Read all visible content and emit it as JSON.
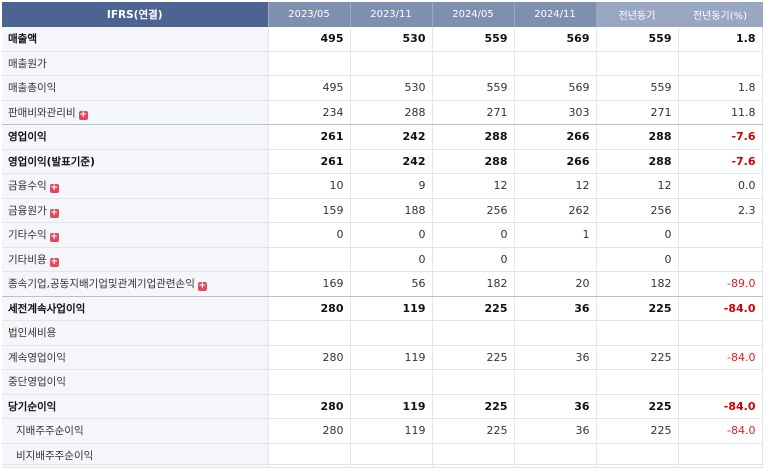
{
  "header": {
    "title": "IFRS(연결)",
    "columns": [
      "2023/05",
      "2023/11",
      "2024/05",
      "2024/11",
      "전년동기",
      "전년동기(%)"
    ]
  },
  "rows": [
    {
      "label": "매출액",
      "bold": true,
      "values": [
        "495",
        "530",
        "559",
        "569",
        "559",
        "1.8"
      ],
      "neg": false
    },
    {
      "label": "매출원가",
      "values": [
        "",
        "",
        "",
        "",
        "",
        ""
      ],
      "neg": false
    },
    {
      "label": "매출총이익",
      "values": [
        "495",
        "530",
        "559",
        "569",
        "559",
        "1.8"
      ],
      "neg": false
    },
    {
      "label": "판매비와관리비",
      "plus": true,
      "values": [
        "234",
        "288",
        "271",
        "303",
        "271",
        "11.8"
      ],
      "neg": false
    },
    {
      "label": "영업이익",
      "bold": true,
      "values": [
        "261",
        "242",
        "288",
        "266",
        "288",
        "-7.6"
      ],
      "neg": true
    },
    {
      "label": "영업이익(발표기준)",
      "bold": true,
      "values": [
        "261",
        "242",
        "288",
        "266",
        "288",
        "-7.6"
      ],
      "neg": true
    },
    {
      "label": "금융수익",
      "plus": true,
      "values": [
        "10",
        "9",
        "12",
        "12",
        "12",
        "0.0"
      ],
      "neg": false
    },
    {
      "label": "금융원가",
      "plus": true,
      "values": [
        "159",
        "188",
        "256",
        "262",
        "256",
        "2.3"
      ],
      "neg": false
    },
    {
      "label": "기타수익",
      "plus": true,
      "values": [
        "0",
        "0",
        "0",
        "1",
        "0",
        ""
      ],
      "neg": false
    },
    {
      "label": "기타비용",
      "plus": true,
      "values": [
        "",
        "0",
        "0",
        "",
        "0",
        ""
      ],
      "neg": false
    },
    {
      "label": "종속기업,공동지배기업및관계기업관련손익",
      "plus": true,
      "values": [
        "169",
        "56",
        "182",
        "20",
        "182",
        "-89.0"
      ],
      "neg": true
    },
    {
      "label": "세전계속사업이익",
      "bold": true,
      "values": [
        "280",
        "119",
        "225",
        "36",
        "225",
        "-84.0"
      ],
      "neg": true
    },
    {
      "label": "법인세비용",
      "values": [
        "",
        "",
        "",
        "",
        "",
        ""
      ],
      "neg": false
    },
    {
      "label": "계속영업이익",
      "values": [
        "280",
        "119",
        "225",
        "36",
        "225",
        "-84.0"
      ],
      "neg": true
    },
    {
      "label": "중단영업이익",
      "values": [
        "",
        "",
        "",
        "",
        "",
        ""
      ],
      "neg": false
    },
    {
      "label": "당기순이익",
      "bold": true,
      "values": [
        "280",
        "119",
        "225",
        "36",
        "225",
        "-84.0"
      ],
      "neg": true
    },
    {
      "label": "지배주주순이익",
      "indent": true,
      "values": [
        "280",
        "119",
        "225",
        "36",
        "225",
        "-84.0"
      ],
      "neg": true
    },
    {
      "label": "비지배주주순이익",
      "indent": true,
      "values": [
        "",
        "",
        "",
        "",
        "",
        ""
      ],
      "neg": false
    }
  ],
  "plus_icon": "+"
}
